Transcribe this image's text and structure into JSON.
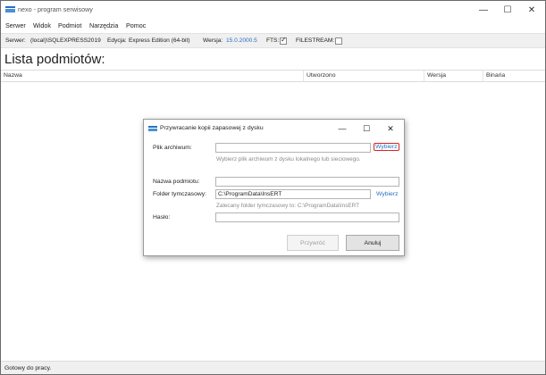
{
  "app": {
    "title": "nexo - program serwisowy",
    "controls": {
      "minimize": "—",
      "maximize": "☐",
      "close": "✕"
    }
  },
  "menu": {
    "items": [
      "Serwer",
      "Widok",
      "Podmiot",
      "Narzędzia",
      "Pomoc"
    ]
  },
  "infobar": {
    "server_label": "Serwer:",
    "server_value": "(local)\\SQLEXPRESS2019",
    "edition_label": "Edycja:",
    "edition_value": "Express Edition (64-bit)",
    "version_label": "Wersja:",
    "version_value": "15.0.2000.5",
    "fts_label": "FTS:",
    "fts_checked": true,
    "filestream_label": "FILESTREAM:",
    "filestream_checked": false,
    "check_glyph": "✓"
  },
  "page": {
    "title": "Lista podmiotów:"
  },
  "list": {
    "columns": [
      "Nazwa",
      "Utworzono",
      "Wersja",
      "Binaria"
    ]
  },
  "status": {
    "text": "Gotowy do pracy."
  },
  "dialog": {
    "title": "Przywracanie kopii zapasowej z dysku",
    "controls": {
      "minimize": "—",
      "maximize": "☐",
      "close": "✕"
    },
    "archive_label": "Plik archiwum:",
    "archive_value": "",
    "archive_button": "Wybierz",
    "archive_hint": "Wybierz plik archiwum z dysku lokalnego lub sieciowego.",
    "entity_label": "Nazwa podmiotu:",
    "entity_value": "",
    "temp_label": "Folder tymczasowy:",
    "temp_value": "C:\\ProgramData\\InsERT",
    "temp_button": "Wybierz",
    "temp_hint": "Zalecany folder tymczasowy to: C:\\ProgramData\\InsERT",
    "password_label": "Hasło:",
    "password_value": "",
    "restore_button": "Przywróć",
    "cancel_button": "Anuluj"
  },
  "colors": {
    "accent_link": "#2a6fbf",
    "highlight": "#dd2222",
    "infobar_bg": "#f0f0f0"
  }
}
